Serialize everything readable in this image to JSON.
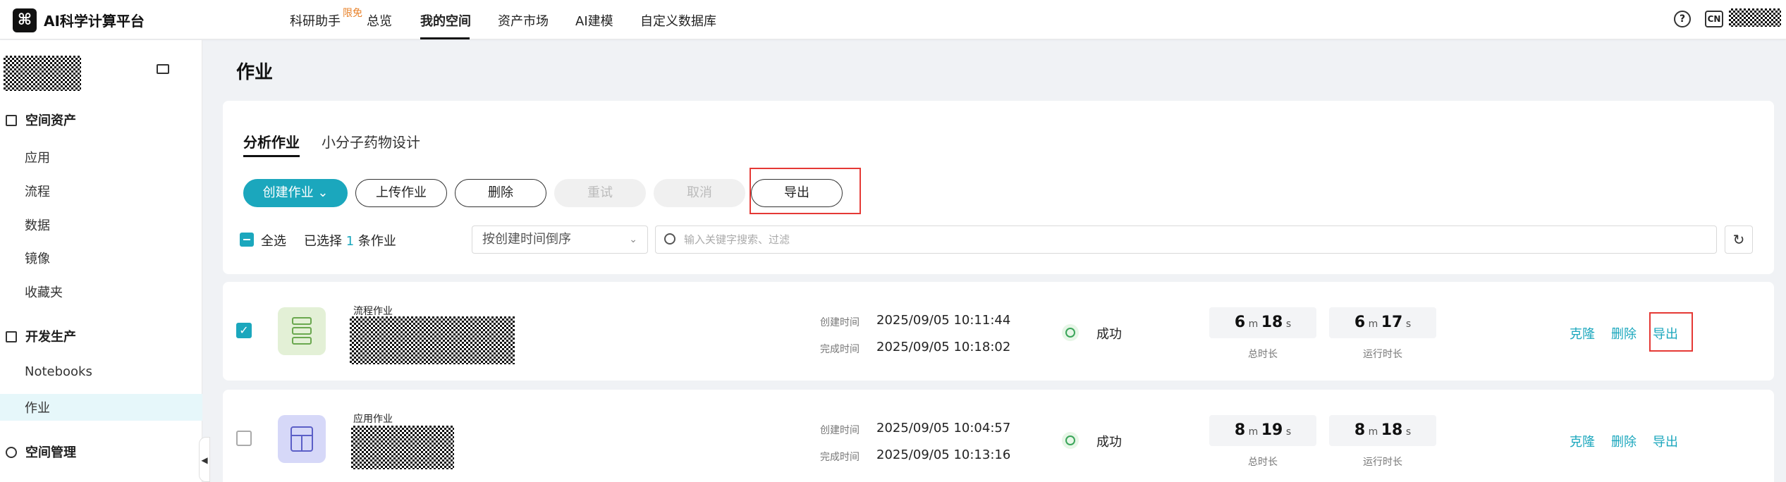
{
  "header": {
    "brand": "AI科学计算平台",
    "nav": [
      "科研助手",
      "总览",
      "我的空间",
      "资产市场",
      "AI建模",
      "自定义数据库"
    ],
    "badge": "限免",
    "help_icon": "?",
    "lang": "CN"
  },
  "sidebar": {
    "sections": [
      {
        "title": "空间资产",
        "items": [
          "应用",
          "流程",
          "数据",
          "镜像",
          "收藏夹"
        ]
      },
      {
        "title": "开发生产",
        "items": [
          "Notebooks",
          "作业"
        ]
      },
      {
        "title": "空间管理",
        "items": []
      }
    ],
    "active_item": "作业"
  },
  "main": {
    "title": "作业",
    "tabs": [
      "分析作业",
      "小分子药物设计"
    ],
    "toolbar": {
      "create": "创建作业",
      "upload": "上传作业",
      "delete": "删除",
      "retry": "重试",
      "cancel": "取消",
      "export": "导出"
    },
    "select_all": "全选",
    "selected_prefix": "已选择",
    "selected_count": "1",
    "selected_suffix": "条作业",
    "sort": "按创建时间倒序",
    "search_placeholder": "输入关键字搜索、过滤"
  },
  "jobs": [
    {
      "type": "流程作业",
      "created_label": "创建时间",
      "created": "2025/09/05 10:11:44",
      "finished_label": "完成时间",
      "finished": "2025/09/05 10:18:02",
      "status": "成功",
      "total": {
        "m": "6",
        "s": "18"
      },
      "total_label": "总时长",
      "run": {
        "m": "6",
        "s": "17"
      },
      "run_label": "运行时长",
      "actions": [
        "克隆",
        "删除",
        "导出"
      ],
      "checked": true
    },
    {
      "type": "应用作业",
      "created_label": "创建时间",
      "created": "2025/09/05 10:04:57",
      "finished_label": "完成时间",
      "finished": "2025/09/05 10:13:16",
      "status": "成功",
      "total": {
        "m": "8",
        "s": "19"
      },
      "total_label": "总时长",
      "run": {
        "m": "8",
        "s": "18"
      },
      "run_label": "运行时长",
      "actions": [
        "克隆",
        "删除",
        "导出"
      ],
      "checked": false
    }
  ],
  "units": {
    "m": "m",
    "s": "s"
  },
  "colors": {
    "accent": "#1ba7bd",
    "highlight": "#e53935",
    "success": "#3aa55a"
  }
}
